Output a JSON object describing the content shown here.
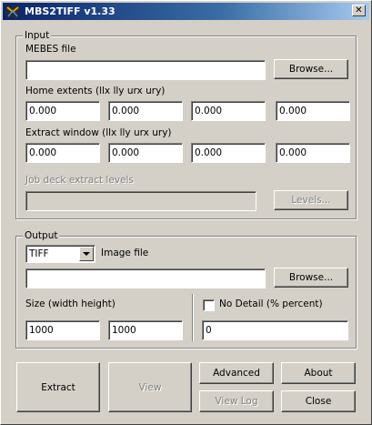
{
  "window": {
    "title": "MBS2TIFF v1.33",
    "close_glyph": "✕"
  },
  "input": {
    "legend": "Input",
    "mebes_label": "MEBES file",
    "mebes_value": "",
    "browse_label": "Browse...",
    "home_label": "Home extents (llx lly urx ury)",
    "home_values": [
      "0.000",
      "0.000",
      "0.000",
      "0.000"
    ],
    "extract_label": "Extract window (llx lly urx ury)",
    "extract_values": [
      "0.000",
      "0.000",
      "0.000",
      "0.000"
    ],
    "jobdeck_label": "Job deck extract levels",
    "jobdeck_value": "",
    "levels_label": "Levels..."
  },
  "output": {
    "legend": "Output",
    "format_value": "TIFF",
    "image_label": "Image file",
    "image_value": "",
    "browse_label": "Browse...",
    "size_label": "Size (width height)",
    "width_value": "1000",
    "height_value": "1000",
    "nodetail_label": "No Detail (% percent)",
    "nodetail_checked": false,
    "nodetail_value": "0"
  },
  "actions": {
    "extract": "Extract",
    "view": "View",
    "advanced": "Advanced",
    "about": "About",
    "viewlog": "View Log",
    "close": "Close"
  }
}
